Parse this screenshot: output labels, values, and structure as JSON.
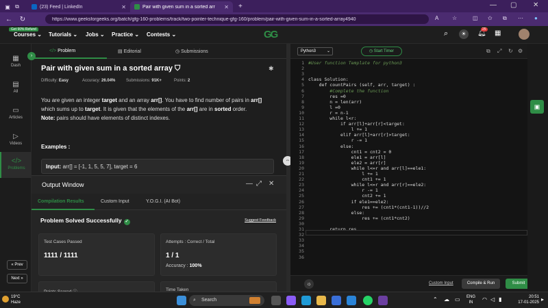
{
  "browser": {
    "tabs": [
      {
        "label": "(23) Feed | LinkedIn",
        "active": false
      },
      {
        "label": "Pair with given sum in a sorted arr",
        "active": true
      }
    ],
    "new_tab": "+",
    "url": "https://www.geeksforgeeks.org/batch/gfg-160-problems/track/two-pointer-technique-gfg-160/problem/pair-with-given-sum-in-a-sorted-array4940"
  },
  "site": {
    "refund_badge": "Get 90% Refund",
    "nav": [
      "Courses",
      "Tutorials",
      "Jobs",
      "Practice",
      "Contests"
    ],
    "logo": "GG",
    "notification_count": "25"
  },
  "rail": {
    "items": [
      "Dash",
      "All",
      "Articles",
      "Videos",
      "Problems"
    ],
    "prev": "« Prev",
    "next": "Next »"
  },
  "problem": {
    "tabs": [
      "Problem",
      "Editorial",
      "Submissions"
    ],
    "title": "Pair with given sum in a sorted array",
    "difficulty_label": "Difficulty:",
    "difficulty": "Easy",
    "accuracy_label": "Accuracy:",
    "accuracy": "26.04%",
    "submissions_label": "Submissions:",
    "submissions": "91K+",
    "points_label": "Points:",
    "points": "2",
    "desc_1a": "You are given an integer ",
    "desc_1b": "target",
    "desc_1c": " and an array ",
    "desc_1d": "arr[]",
    "desc_1e": ". You have to find number of pairs in ",
    "desc_1f": "arr[]",
    "desc_1g": " which sums up to ",
    "desc_1h": "target",
    "desc_1i": ". It is given that the elements of the ",
    "desc_1j": "arr[]",
    "desc_1k": " are in ",
    "desc_1l": "sorted",
    "desc_1m": " order.",
    "note_label": "Note:",
    "note": " pairs should have elements of distinct indexes.",
    "examples": "Examples :",
    "example_input_label": "Input:",
    "example_input": " arr[] = [-1, 1, 5, 5, 7], target = 6"
  },
  "output": {
    "title": "Output Window",
    "tabs": [
      "Compilation Results",
      "Custom Input",
      "Y.O.G.I. (AI Bot)"
    ],
    "status": "Problem Solved Successfully",
    "feedback": "Suggest Feedback",
    "test_cases_label": "Test Cases Passed",
    "test_cases": "1111 / 1111",
    "attempts_label": "Attempts : Correct / Total",
    "attempts": "1 / 1",
    "accuracy_label": "Accuracy :",
    "accuracy": "100%",
    "points_scored_label": "Points Scored",
    "time_taken_label": "Time Taken"
  },
  "editor": {
    "language": "Python3",
    "timer": "Start Timer",
    "lines": [
      "#User function Template for python3",
      "",
      "",
      "class Solution:",
      "    def countPairs (self, arr, target) :",
      "        #Complete the function",
      "        res =0",
      "        n = len(arr)",
      "        l =0",
      "        r = n-1",
      "        while l<r:",
      "            if arr[l]+arr[r]<target:",
      "                l += 1",
      "            elif arr[l]+arr[r]>target:",
      "                r -= 1",
      "            else:",
      "                cnt1 = cnt2 = 0",
      "                ele1 = arr[l]",
      "                ele2 = arr[r]",
      "                while l<=r and arr[l]==ele1:",
      "                    l += 1",
      "                    cnt1 += 1",
      "                while l<=r and arr[r]==ele2:",
      "                    r -= 1",
      "                    cnt2 += 1",
      "                if ele1==ele2:",
      "                    res += (cnt1*(cnt1-1))//2",
      "                else:",
      "                    res += (cnt1*cnt2)",
      "",
      "        return res",
      "",
      "",
      "",
      "",
      ""
    ],
    "custom_input": "Custom Input",
    "compile": "Compile & Run",
    "submit": "Submit"
  },
  "taskbar": {
    "temp": "19°C",
    "weather": "Haze",
    "search": "Search",
    "lang_1": "ENG",
    "lang_2": "IN",
    "time": "20:51",
    "date": "17-01-2025"
  },
  "colors": {
    "accent": "#2f8d46",
    "browser": "#4b2b70"
  }
}
